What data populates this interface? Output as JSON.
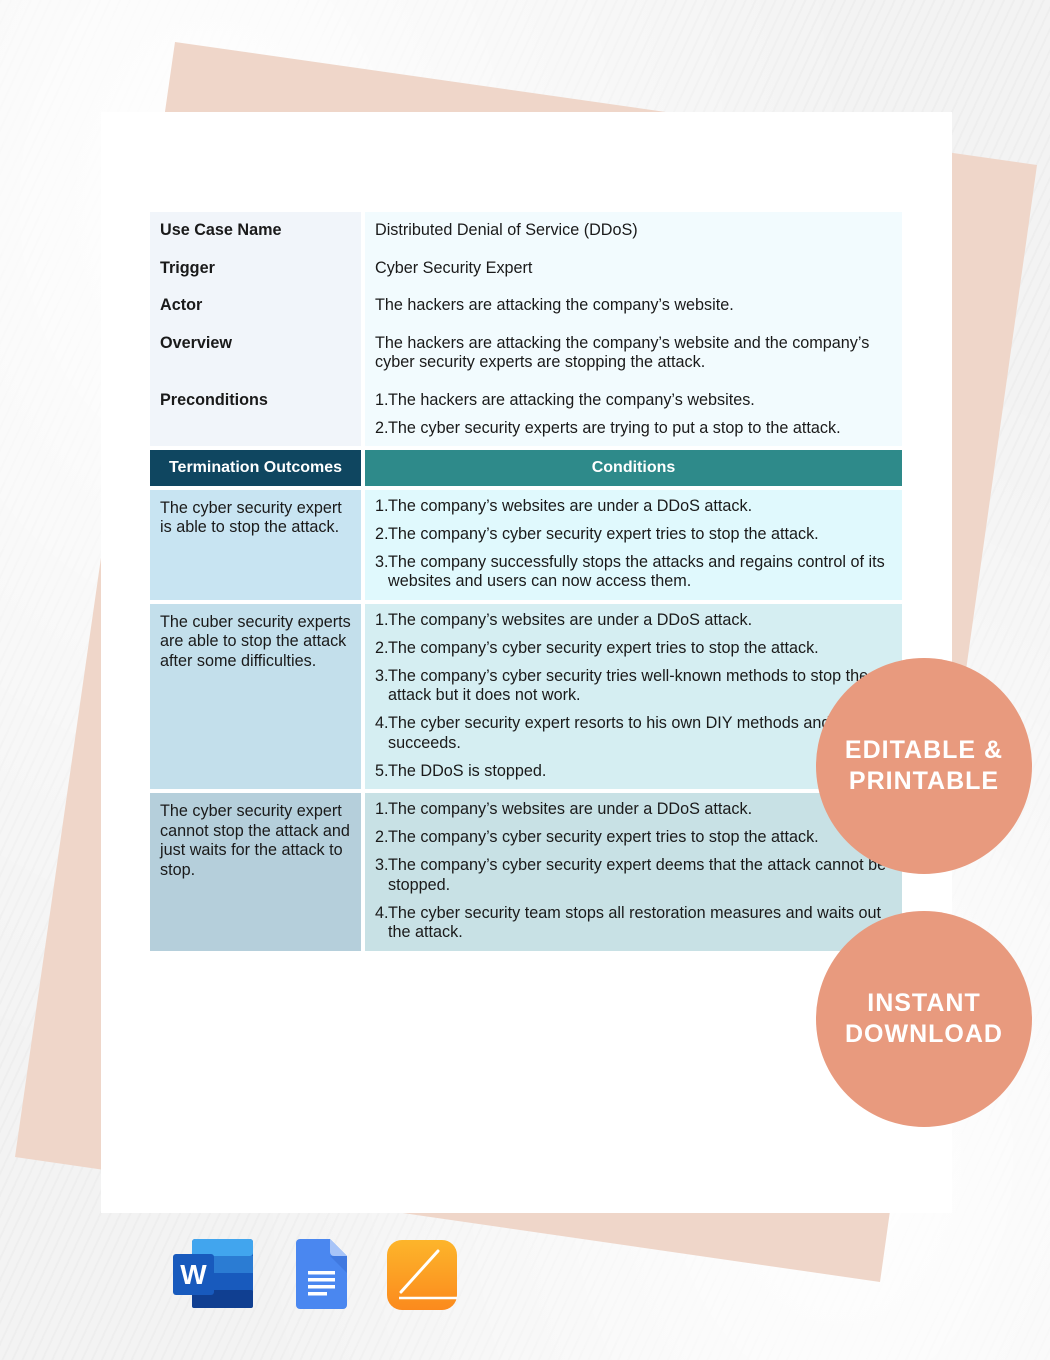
{
  "document": {
    "info_rows": [
      {
        "label": "Use Case Name",
        "value": "Distributed Denial of Service (DDoS)"
      },
      {
        "label": "Trigger",
        "value": "Cyber Security Expert"
      },
      {
        "label": "Actor",
        "value": "The hackers are attacking the company’s website."
      },
      {
        "label": "Overview",
        "value": "The hackers are attacking the company’s website and the company’s cyber security experts are stopping the attack."
      }
    ],
    "preconditions": {
      "label": "Preconditions",
      "items": [
        {
          "num": "1.",
          "text": "The hackers are attacking the company’s websites."
        },
        {
          "num": "2.",
          "text": "The cyber security experts are trying to put a stop to the attack."
        }
      ]
    },
    "outcomes_table": {
      "headers": [
        "Termination Outcomes",
        "Conditions"
      ],
      "rows": [
        {
          "outcome": "The cyber security expert is able to stop the attack.",
          "conditions": [
            {
              "num": "1.",
              "text": "The company’s websites are under a DDoS attack."
            },
            {
              "num": "2.",
              "text": "The company’s cyber security expert tries to stop the attack."
            },
            {
              "num": "3.",
              "text": "The company successfully stops the attacks and regains control of its websites and users can now access them."
            }
          ]
        },
        {
          "outcome": "The cuber security experts are able to stop the attack after some difficulties.",
          "conditions": [
            {
              "num": "1.",
              "text": "The company’s websites are under a DDoS attack."
            },
            {
              "num": "2.",
              "text": "The company’s cyber security expert tries to stop the attack."
            },
            {
              "num": "3.",
              "text": "The company’s cyber security tries well-known methods to stop the attack but it does not work."
            },
            {
              "num": "4.",
              "text": "The cyber security expert resorts to his own DIY methods and succeeds."
            },
            {
              "num": "5.",
              "text": "The DDoS is stopped."
            }
          ]
        },
        {
          "outcome": "The cyber security expert cannot stop the attack and just waits for the attack to stop.",
          "conditions": [
            {
              "num": "1.",
              "text": "The company’s websites are under a DDoS attack."
            },
            {
              "num": "2.",
              "text": "The company’s cyber security expert tries to stop the attack."
            },
            {
              "num": "3.",
              "text": "The company’s cyber security expert deems that the attack cannot be stopped."
            },
            {
              "num": "4.",
              "text": "The cyber security team stops all restoration measures and waits out the attack."
            }
          ]
        }
      ]
    }
  },
  "badges": [
    {
      "line1": "EDITABLE &",
      "line2": "PRINTABLE"
    },
    {
      "line1": "INSTANT",
      "line2": "DOWNLOAD"
    }
  ],
  "apps": [
    {
      "name": "Microsoft Word",
      "icon": "word-icon",
      "letter": "W"
    },
    {
      "name": "Google Docs",
      "icon": "google-docs-icon"
    },
    {
      "name": "Apple Pages",
      "icon": "pages-icon"
    }
  ],
  "colors": {
    "header_dark": "#0f4660",
    "header_teal": "#2e8a8a",
    "badge": "#e89a7e",
    "backing_sheet": "#efd6c9"
  }
}
